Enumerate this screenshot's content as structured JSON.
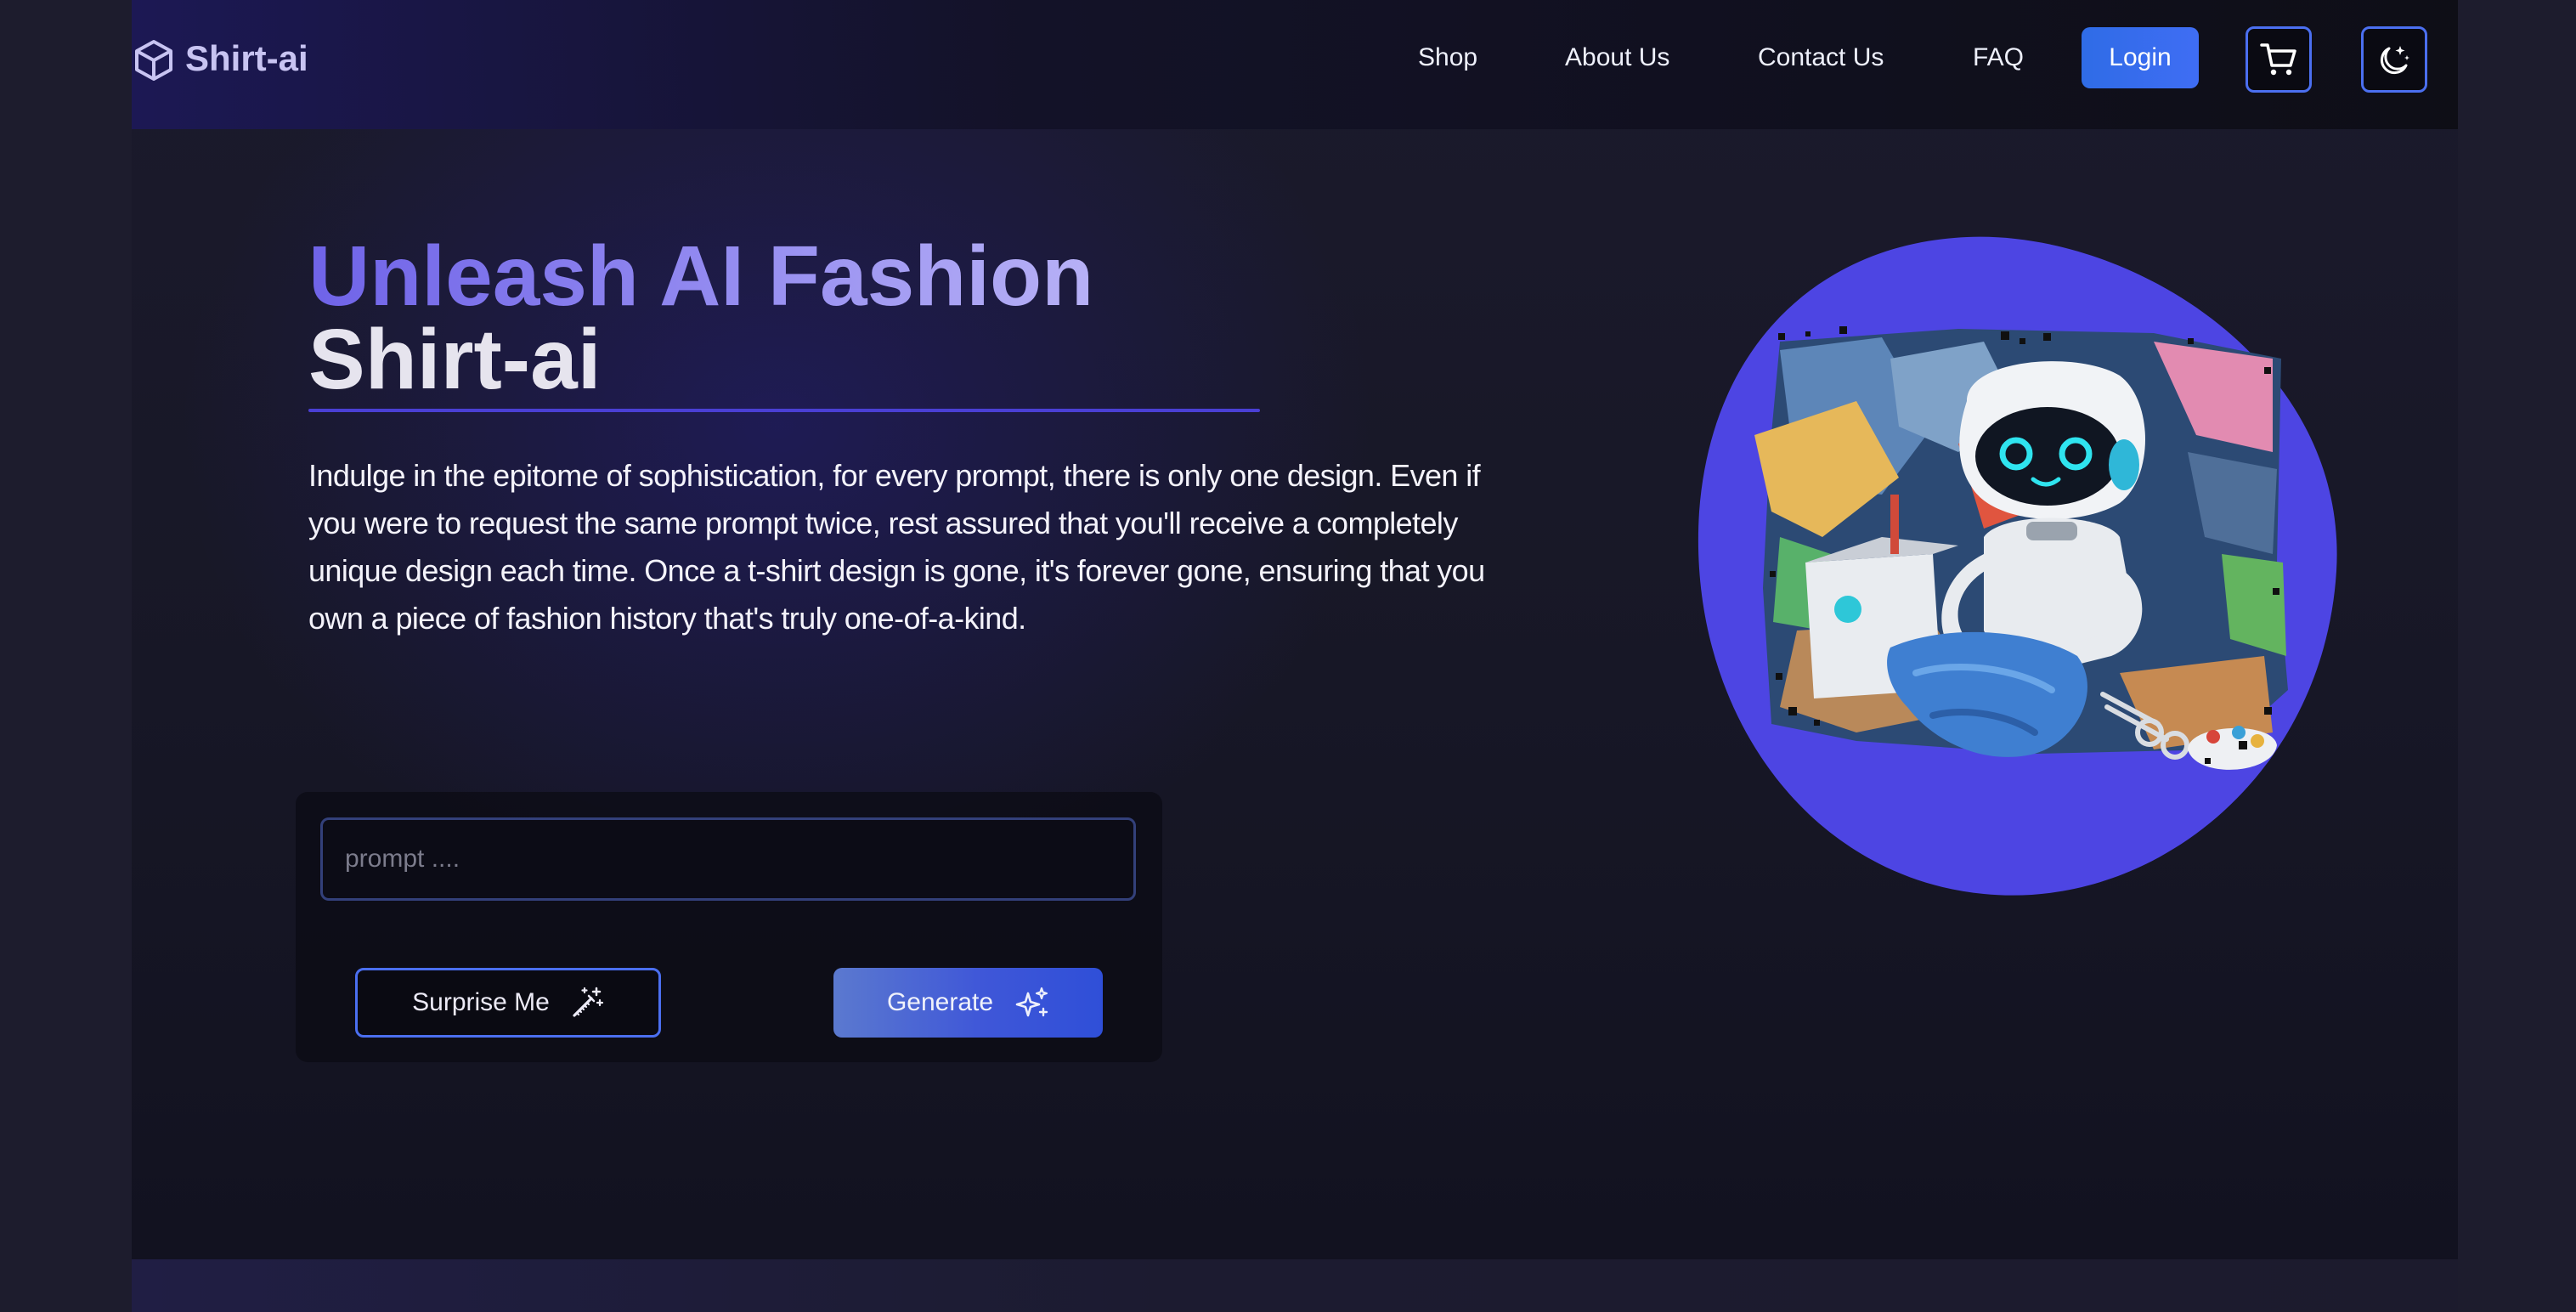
{
  "header": {
    "brand_name": "Shirt-ai",
    "brand_icon": "cube-icon",
    "nav": [
      "Shop",
      "About Us",
      "Contact Us",
      "FAQ"
    ],
    "login_label": "Login",
    "cart_icon": "shopping-cart-icon",
    "theme_icon": "moon-stars-icon"
  },
  "hero": {
    "title_line1": "Unleash AI Fashion",
    "title_line2": "Shirt-ai",
    "description": "Indulge in the epitome of sophistication, for every prompt, there is only one design. Even if you were to request the same prompt twice, rest assured that you'll receive a completely unique design each time. Once a t-shirt design is gone, it's forever gone, ensuring that you own a piece of fashion history that's truly one-of-a-kind."
  },
  "generator": {
    "prompt_value": "",
    "prompt_placeholder": "prompt ....",
    "surprise_label": "Surprise Me",
    "surprise_icon": "magic-wand-icon",
    "generate_label": "Generate",
    "generate_icon": "sparkles-icon"
  },
  "colors": {
    "accent": "#4d45e3",
    "button_blue": "#3f6df4",
    "background": "#171726"
  }
}
